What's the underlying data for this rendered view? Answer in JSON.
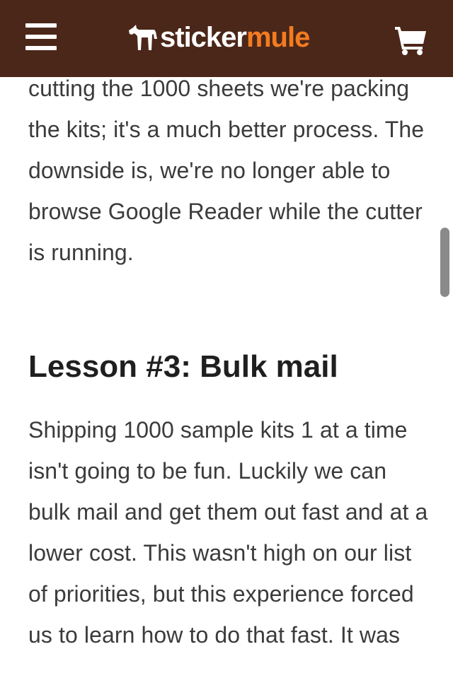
{
  "header": {
    "logo_text_1": "sticker",
    "logo_text_2": "mule",
    "brand_color": "#4b2719",
    "accent_color": "#f47b20",
    "menu_icon": "hamburger-menu-icon",
    "cart_icon": "shopping-cart-icon"
  },
  "article": {
    "paragraph_top": "cutting the 1000 sheets we're packing the kits; it's a much better process. The downside is, we're no longer able to browse Google Reader while the cutter is running.",
    "heading": "Lesson #3: Bulk mail",
    "paragraph_bottom": "Shipping 1000 sample kits 1 at a time isn't going to be fun. Luckily we can bulk mail and get them out fast and at a lower cost. This wasn't high on our list of priorities, but this experience forced us to learn how to do that fast. It was"
  }
}
